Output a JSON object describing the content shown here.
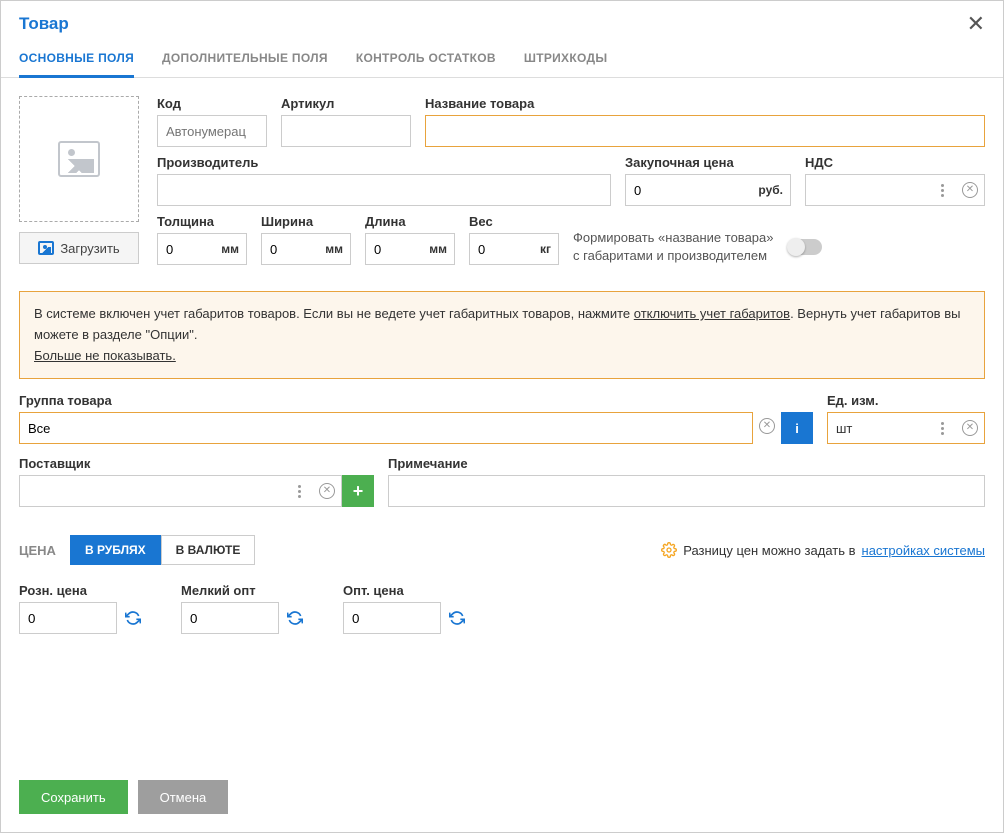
{
  "header": {
    "title": "Товар"
  },
  "tabs": [
    "ОСНОВНЫЕ ПОЛЯ",
    "ДОПОЛНИТЕЛЬНЫЕ ПОЛЯ",
    "КОНТРОЛЬ ОСТАТКОВ",
    "ШТРИХКОДЫ"
  ],
  "upload": {
    "label": "Загрузить"
  },
  "fields": {
    "code": {
      "label": "Код",
      "placeholder": "Автонумерац"
    },
    "article": {
      "label": "Артикул"
    },
    "name": {
      "label": "Название товара"
    },
    "manufacturer": {
      "label": "Производитель"
    },
    "purchase": {
      "label": "Закупочная цена",
      "value": "0",
      "unit": "руб."
    },
    "nds": {
      "label": "НДС"
    },
    "thickness": {
      "label": "Толщина",
      "value": "0",
      "unit": "мм"
    },
    "width": {
      "label": "Ширина",
      "value": "0",
      "unit": "мм"
    },
    "length": {
      "label": "Длина",
      "value": "0",
      "unit": "мм"
    },
    "weight": {
      "label": "Вес",
      "value": "0",
      "unit": "кг"
    }
  },
  "toggle": {
    "line1": "Формировать «название товара»",
    "line2": "с габаритами и производителем"
  },
  "warning": {
    "text1": "В системе включен учет габаритов товаров. Если вы не ведете учет габаритных товаров, нажмите ",
    "link1": "отключить учет габаритов",
    "text2": ". Вернуть учет габаритов вы можете в разделе \"Опции\".",
    "link2": "Больше не показывать."
  },
  "group": {
    "label": "Группа товара",
    "value": "Все"
  },
  "unit_measure": {
    "label": "Ед. изм.",
    "value": "шт"
  },
  "supplier": {
    "label": "Поставщик"
  },
  "note": {
    "label": "Примечание"
  },
  "price_section": {
    "label": "ЦЕНА",
    "tab_rub": "В РУБЛЯХ",
    "tab_cur": "В ВАЛЮТЕ",
    "hint_text": "Разницу цен можно задать в ",
    "hint_link": "настройках системы"
  },
  "prices": {
    "retail": {
      "label": "Розн. цена",
      "value": "0"
    },
    "small_wholesale": {
      "label": "Мелкий опт",
      "value": "0"
    },
    "wholesale": {
      "label": "Опт. цена",
      "value": "0"
    }
  },
  "footer": {
    "save": "Сохранить",
    "cancel": "Отмена"
  }
}
